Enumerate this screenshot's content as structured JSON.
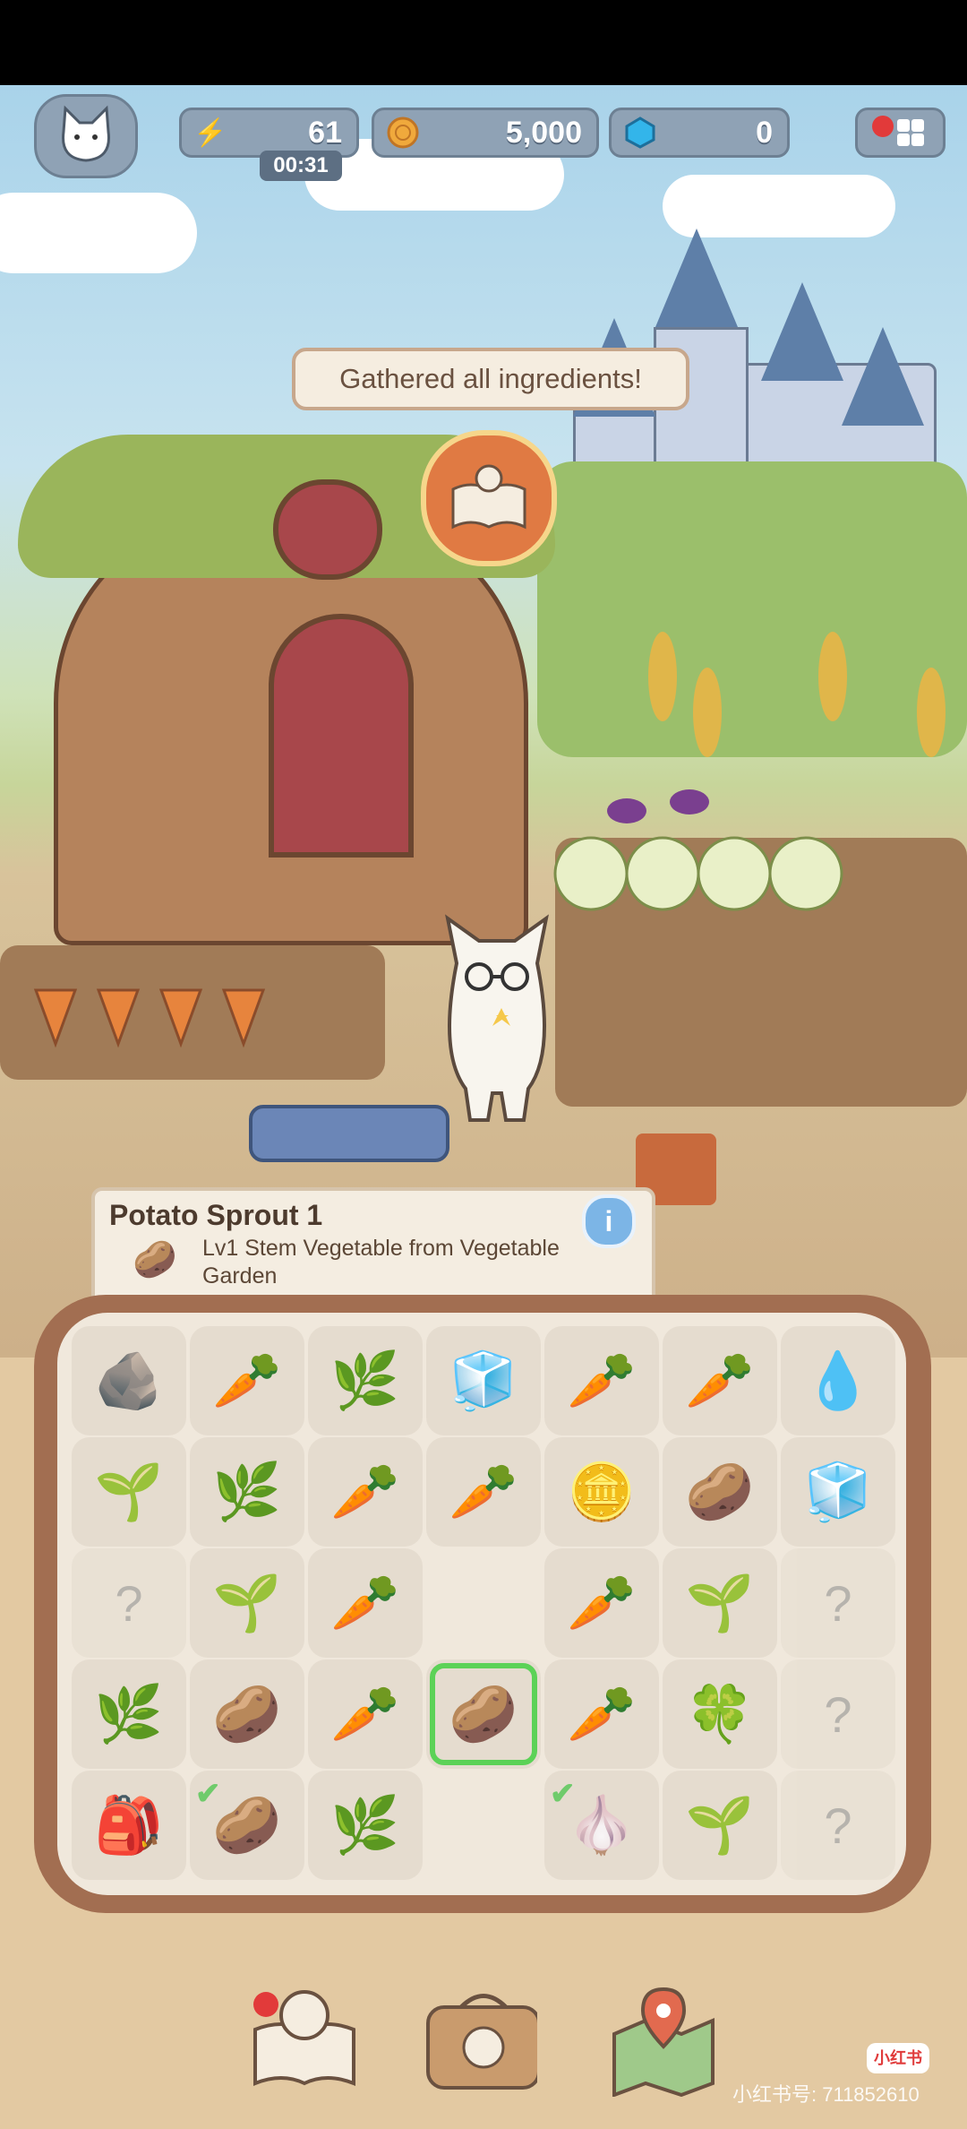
{
  "hud": {
    "energy": {
      "value": "61",
      "icon": "lightning-icon",
      "timer": "00:31"
    },
    "coins": {
      "value": "5,000",
      "icon": "coin-icon"
    },
    "gems": {
      "value": "0",
      "icon": "diamond-icon"
    },
    "avatar": "cat-avatar-icon",
    "menu": "menu-icon"
  },
  "banner": {
    "text": "Gathered all ingredients!"
  },
  "info": {
    "title": "Potato Sprout 1",
    "description": "Lv1 Stem Vegetable from Vegetable Garden",
    "button": "i"
  },
  "board": {
    "rows": [
      [
        "ore",
        "carrot",
        "carrot-sprout",
        "salt-block",
        "carrot",
        "carrot",
        "dropper"
      ],
      [
        "seedling",
        "carrot-sprout",
        "carrot",
        "carrot",
        "coin",
        "potato-sprout",
        "salt-block"
      ],
      [
        "locked-box",
        "seedling",
        "carrot",
        "empty",
        "carrot",
        "seedling",
        "locked-bag"
      ],
      [
        "leaf-plant",
        "potato-plant",
        "carrot",
        "potato-sprout-selected",
        "carrot",
        "clover",
        "locked-box"
      ],
      [
        "sack",
        "potato-checked",
        "carrot-sprout",
        "empty",
        "garlic-checked",
        "sprout",
        "locked-box"
      ]
    ]
  },
  "nav": {
    "left_icon": "recipe-book-icon",
    "center_icon": "bag-icon",
    "right_icon": "map-icon"
  },
  "watermark": {
    "text": "小红书号: 711852610",
    "logo": "小红书"
  },
  "colors": {
    "board": "#a26e51",
    "selection": "#5cd257",
    "banner_border": "#c7a78c"
  }
}
